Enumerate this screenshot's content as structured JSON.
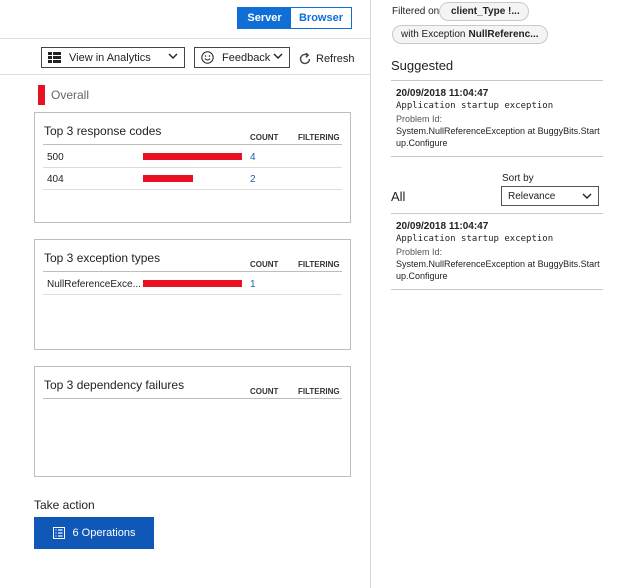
{
  "mode_toggle": {
    "server": "Server",
    "browser": "Browser",
    "selected": "Server"
  },
  "toolbar": {
    "analytics_label": "View in Analytics",
    "feedback_label": "Feedback",
    "refresh_label": "Refresh"
  },
  "overall": {
    "label": "Overall",
    "color": "#e81123"
  },
  "cards": {
    "response_codes": {
      "title": "Top 3 response codes",
      "count_header": "COUNT",
      "filtering_header": "FILTERING",
      "rows": [
        {
          "label": "500",
          "count": "4",
          "fraction": 1.0
        },
        {
          "label": "404",
          "count": "2",
          "fraction": 0.5
        }
      ]
    },
    "exception_types": {
      "title": "Top 3 exception types",
      "count_header": "COUNT",
      "filtering_header": "FILTERING",
      "rows": [
        {
          "label": "NullReferenceExce...",
          "count": "1",
          "fraction": 1.0
        }
      ]
    },
    "dependency_failures": {
      "title": "Top 3 dependency failures",
      "count_header": "COUNT",
      "filtering_header": "FILTERING",
      "rows": []
    }
  },
  "take_action": {
    "title": "Take action",
    "operations_label": "6 Operations"
  },
  "filters": {
    "label": "Filtered on",
    "pill1": {
      "value": "client_Type !..."
    },
    "pill2": {
      "prefix": "with Exception",
      "value": "NullReferenc..."
    }
  },
  "suggested": {
    "title": "Suggested",
    "entry": {
      "timestamp": "20/09/2018 11:04:47",
      "exception": "Application startup exception",
      "problem_label": "Problem Id:",
      "problem_value": "System.NullReferenceException at BuggyBits.Startup.Configure"
    }
  },
  "all": {
    "title": "All",
    "sort_label": "Sort by",
    "sort_value": "Relevance",
    "entry": {
      "timestamp": "20/09/2018 11:04:47",
      "exception": "Application startup exception",
      "problem_label": "Problem Id:",
      "problem_value": "System.NullReferenceException at BuggyBits.Startup.Configure"
    }
  },
  "icons": {
    "analytics": "analytics-grid-icon",
    "feedback": "smiley-icon",
    "refresh": "refresh-icon",
    "operations": "list-icon",
    "dropdown": "chevron-down-icon"
  }
}
